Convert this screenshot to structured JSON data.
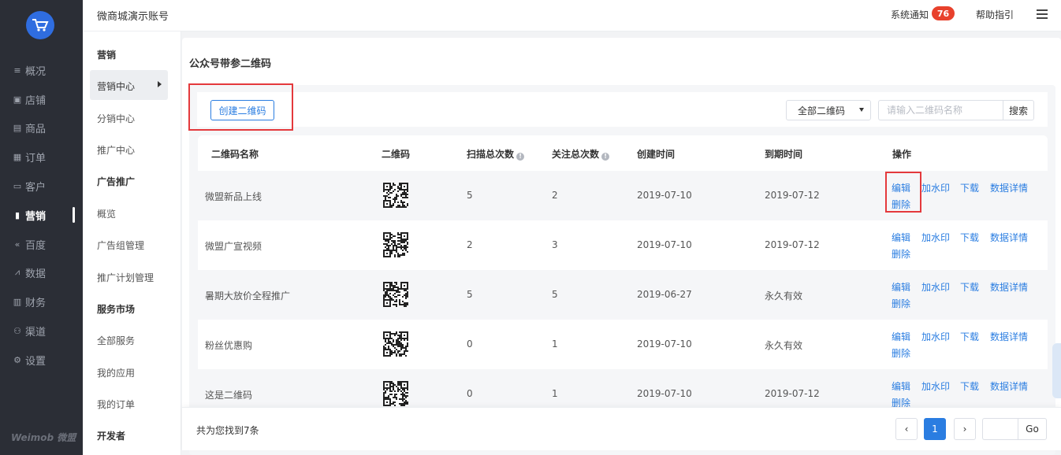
{
  "header": {
    "shop_name": "微商城演示账号",
    "notice_label": "系统通知",
    "notice_count": "76",
    "help_label": "帮助指引"
  },
  "nav": {
    "items": [
      {
        "label": "概况",
        "icon": "overview-icon"
      },
      {
        "label": "店铺",
        "icon": "store-icon"
      },
      {
        "label": "商品",
        "icon": "goods-icon"
      },
      {
        "label": "订单",
        "icon": "order-icon"
      },
      {
        "label": "客户",
        "icon": "customer-icon"
      },
      {
        "label": "营销",
        "icon": "marketing-icon",
        "active": true
      },
      {
        "label": "百度",
        "icon": "baidu-icon"
      },
      {
        "label": "数据",
        "icon": "data-icon"
      },
      {
        "label": "财务",
        "icon": "finance-icon"
      },
      {
        "label": "渠道",
        "icon": "channel-icon"
      },
      {
        "label": "设置",
        "icon": "settings-icon"
      }
    ],
    "brand": "Weimob 微盟"
  },
  "submenu": {
    "group1": "营销",
    "items1": [
      "营销中心",
      "分销中心",
      "推广中心"
    ],
    "group2": "广告推广",
    "items2": [
      "概览",
      "广告组管理",
      "推广计划管理"
    ],
    "group3": "服务市场",
    "items3": [
      "全部服务",
      "我的应用",
      "我的订单"
    ],
    "group4": "开发者"
  },
  "page": {
    "title": "公众号带参二维码",
    "create_button": "创建二维码",
    "filter_value": "全部二维码",
    "search_placeholder": "请输入二维码名称",
    "search_button": "搜索"
  },
  "table": {
    "headers": {
      "name": "二维码名称",
      "qr": "二维码",
      "scans": "扫描总次数",
      "follows": "关注总次数",
      "created": "创建时间",
      "expires": "到期时间",
      "actions": "操作"
    },
    "rows": [
      {
        "name": "微盟新品上线",
        "scans": "5",
        "follows": "2",
        "created": "2019-07-10",
        "expires": "2019-07-12"
      },
      {
        "name": "微盟广宣视频",
        "scans": "2",
        "follows": "3",
        "created": "2019-07-10",
        "expires": "2019-07-12"
      },
      {
        "name": "暑期大放价全程推广",
        "scans": "5",
        "follows": "5",
        "created": "2019-06-27",
        "expires": "永久有效"
      },
      {
        "name": "粉丝优惠购",
        "scans": "0",
        "follows": "1",
        "created": "2019-07-10",
        "expires": "永久有效"
      },
      {
        "name": "这是二维码",
        "scans": "0",
        "follows": "1",
        "created": "2019-07-10",
        "expires": "2019-07-12"
      }
    ],
    "actions": {
      "edit": "编辑",
      "watermark": "加水印",
      "download": "下载",
      "detail": "数据详情",
      "delete": "删除"
    }
  },
  "pager": {
    "found_text": "共为您找到7条",
    "current_page": "1",
    "go_label": "Go"
  },
  "colors": {
    "accent": "#2a7de1",
    "badge": "#e8412c",
    "highlight_box": "#e4393c",
    "nav_bg": "#2b2e36"
  }
}
